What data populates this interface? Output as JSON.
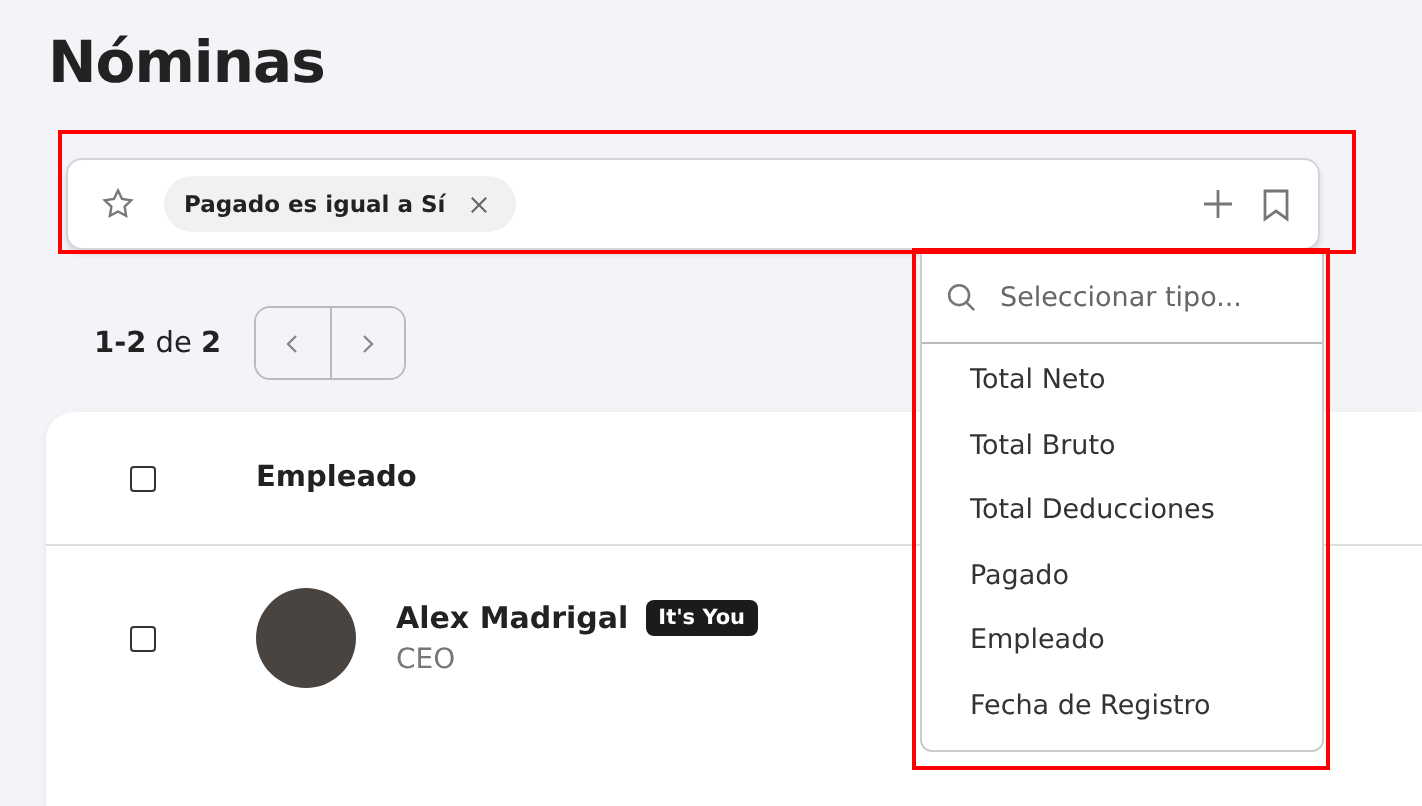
{
  "page": {
    "title": "Nóminas"
  },
  "filter_bar": {
    "chips": [
      {
        "label": "Pagado es igual a Sí"
      }
    ]
  },
  "type_dropdown": {
    "search": {
      "placeholder": "Seleccionar tipo..."
    },
    "options": [
      {
        "label": "Total Neto"
      },
      {
        "label": "Total Bruto"
      },
      {
        "label": "Total Deducciones"
      },
      {
        "label": "Pagado"
      },
      {
        "label": "Empleado"
      },
      {
        "label": "Fecha de Registro"
      }
    ]
  },
  "pagination": {
    "summary": "**1-2** de **2**"
  },
  "table": {
    "select_all": {
      "checked": false
    },
    "columns": [
      "Empleado"
    ],
    "rows": [
      {
        "checked": false,
        "name": "Alex Madrigal",
        "badge": "It's You",
        "role": "CEO"
      }
    ]
  }
}
